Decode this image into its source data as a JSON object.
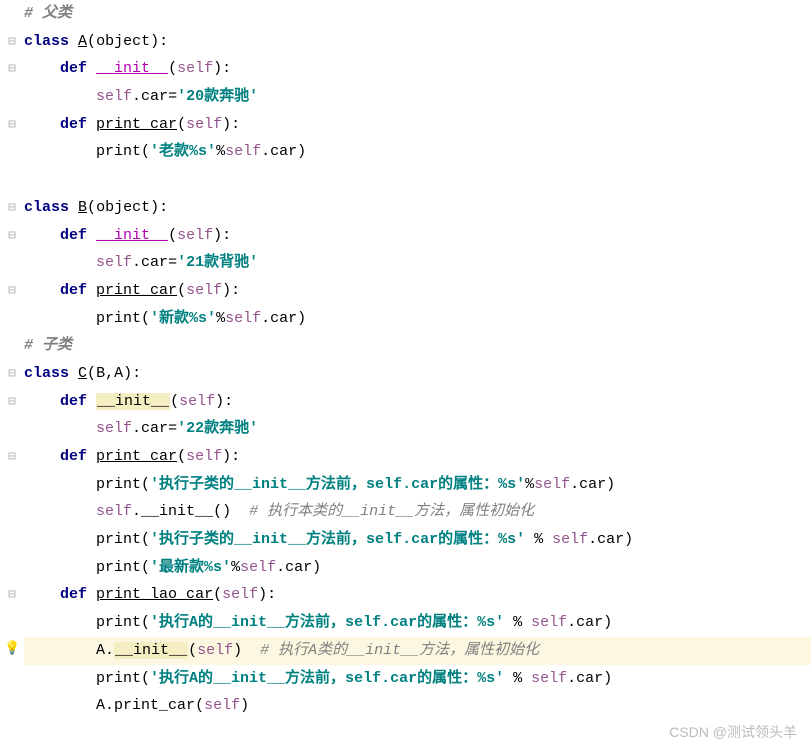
{
  "watermark": "CSDN @测试领头羊",
  "bulb_icon": "💡",
  "tokens": {
    "class": "class",
    "def": "def",
    "object": "object",
    "self": "self",
    "A": "A",
    "B": "B",
    "C": "C",
    "init": "__init__",
    "print_car": "print_car",
    "print_lao_car": "print_lao_car",
    "car": "car",
    "print": "print"
  },
  "strings": {
    "s20": "'20款奔驰'",
    "s21": "'21款背驰'",
    "s22": "'22款奔驰'",
    "lao": "'老款%s'",
    "xin": "'新款%s'",
    "zuixin": "'最新款%s'",
    "exec_sub_before": "'执行子类的__init__方法前，self.car的属性：%s'",
    "exec_a_before": "'执行A的__init__方法前，self.car的属性：%s'"
  },
  "comments": {
    "parent": "# 父类",
    "child": "# 子类",
    "exec_self_init": "# 执行本类的__init__方法，属性初始化",
    "exec_a_init": "# 执行A类的__init__方法，属性初始化"
  },
  "folds": [
    "empty",
    "minus",
    "minus",
    "empty",
    "minus",
    "empty",
    "empty",
    "minus",
    "minus",
    "empty",
    "minus",
    "empty",
    "empty",
    "minus",
    "minus",
    "empty",
    "minus",
    "empty",
    "empty",
    "empty",
    "empty",
    "minus",
    "empty",
    "empty",
    "empty",
    "empty"
  ]
}
